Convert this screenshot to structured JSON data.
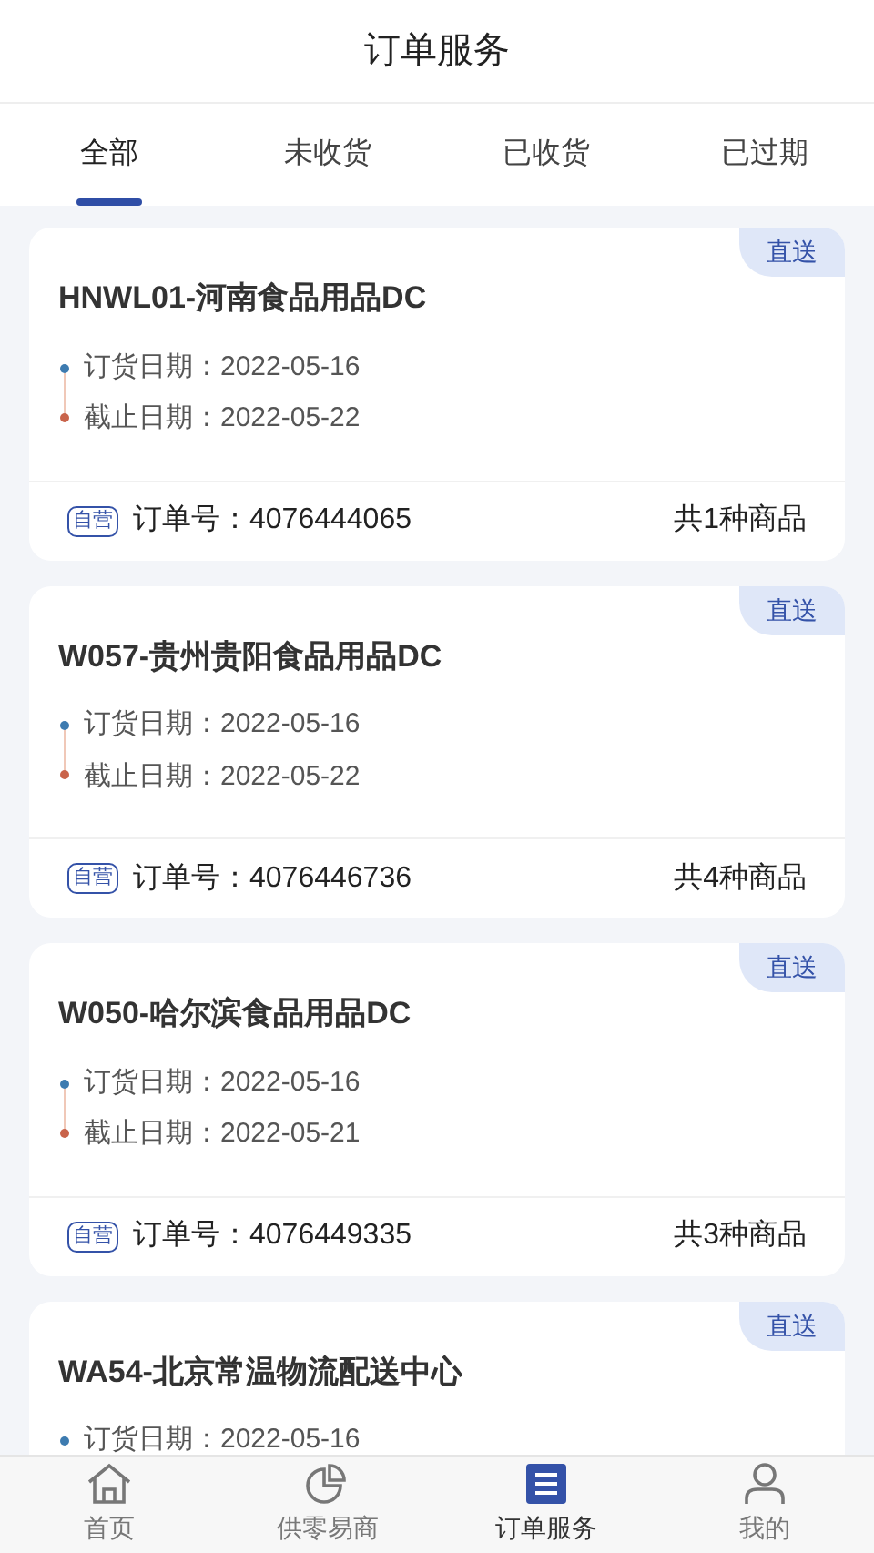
{
  "header": {
    "title": "订单服务"
  },
  "tabs": [
    {
      "label": "全部",
      "selected": true
    },
    {
      "label": "未收货",
      "selected": false
    },
    {
      "label": "已收货",
      "selected": false
    },
    {
      "label": "已过期",
      "selected": false
    }
  ],
  "orders": [
    {
      "badge": "直送",
      "name": "HNWL01-河南食品用品DC",
      "order_date": "订货日期：2022-05-16",
      "deadline": "截止日期：2022-05-22",
      "tag": "自营",
      "order_no": "订单号：4076444065",
      "count": "共1种商品"
    },
    {
      "badge": "直送",
      "name": "W057-贵州贵阳食品用品DC",
      "order_date": "订货日期：2022-05-16",
      "deadline": "截止日期：2022-05-22",
      "tag": "自营",
      "order_no": "订单号：4076446736",
      "count": "共4种商品"
    },
    {
      "badge": "直送",
      "name": "W050-哈尔滨食品用品DC",
      "order_date": "订货日期：2022-05-16",
      "deadline": "截止日期：2022-05-21",
      "tag": "自营",
      "order_no": "订单号：4076449335",
      "count": "共3种商品"
    },
    {
      "badge": "直送",
      "name": "WA54-北京常温物流配送中心",
      "order_date": "订货日期：2022-05-16"
    }
  ],
  "bottom_nav": [
    {
      "kind": "home",
      "label": "首页",
      "selected": false
    },
    {
      "kind": "chart",
      "label": "供零易商",
      "selected": false
    },
    {
      "kind": "list",
      "label": "订单服务",
      "selected": true
    },
    {
      "kind": "user",
      "label": "我的",
      "selected": false
    }
  ]
}
